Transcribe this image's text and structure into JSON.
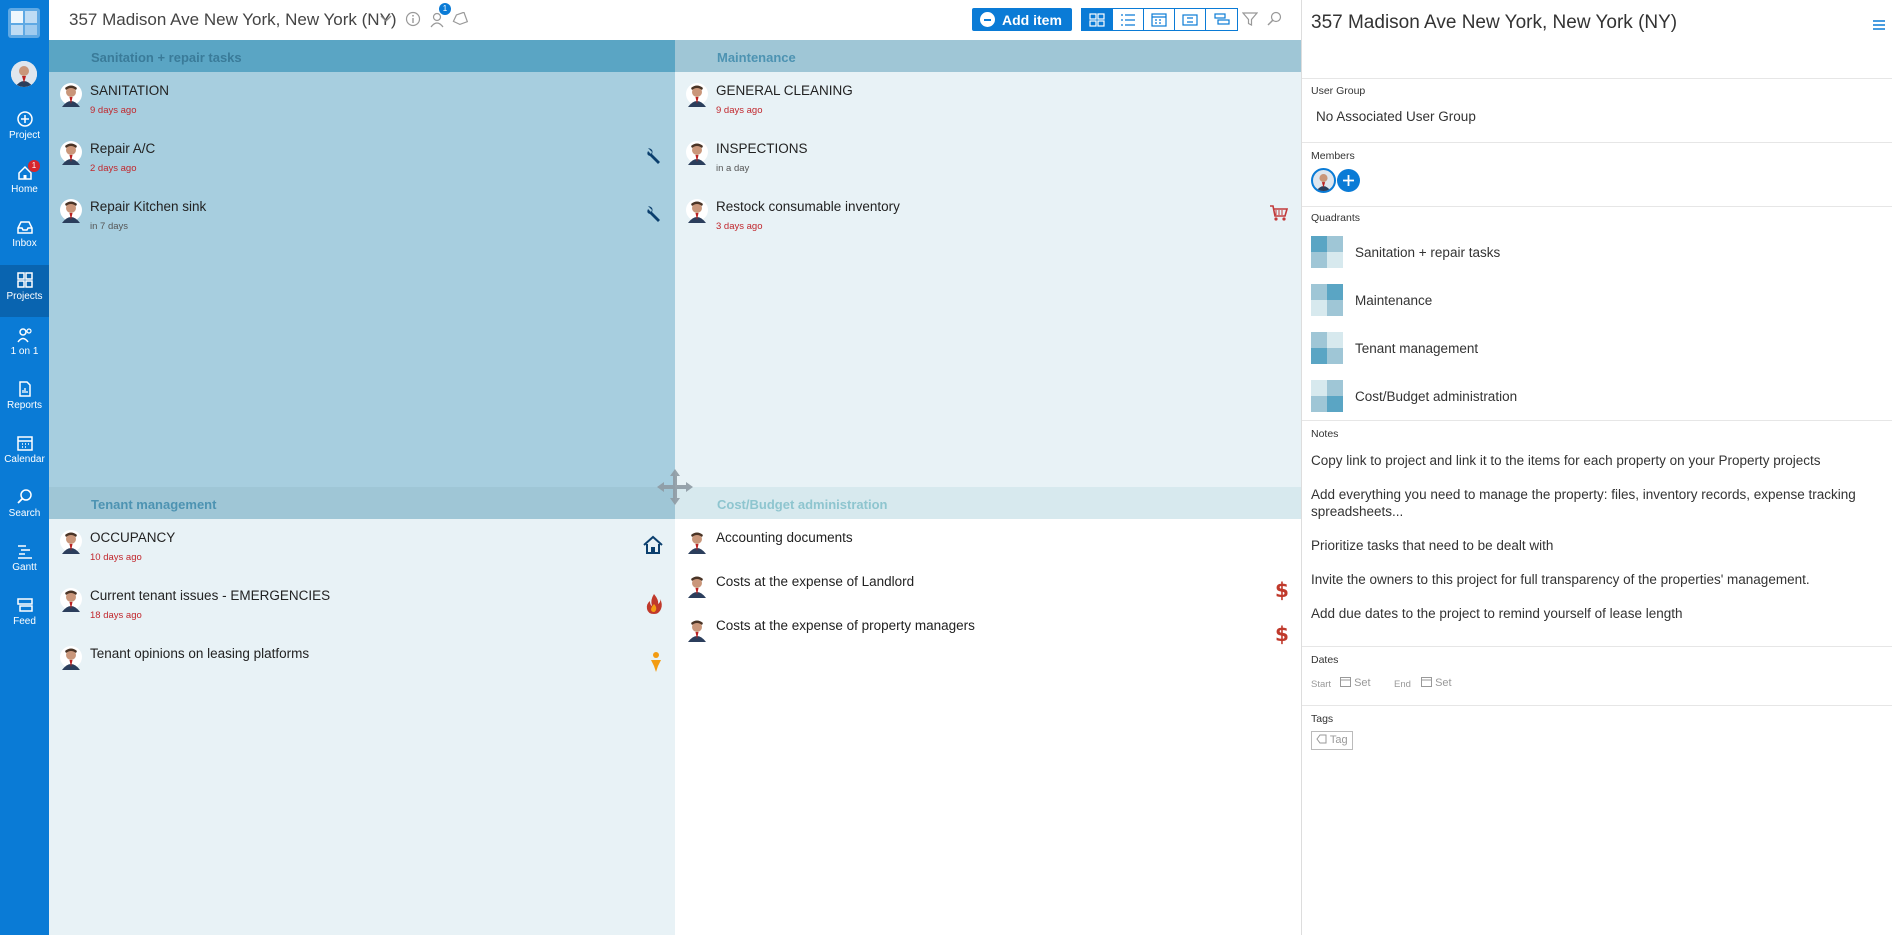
{
  "sidebar": {
    "items": [
      {
        "label": "Project",
        "icon": "plus-circle-icon"
      },
      {
        "label": "Home",
        "icon": "home-icon",
        "badge": "1"
      },
      {
        "label": "Inbox",
        "icon": "inbox-icon"
      },
      {
        "label": "Projects",
        "icon": "grid-icon",
        "active": true
      },
      {
        "label": "1 on 1",
        "icon": "people-icon"
      },
      {
        "label": "Reports",
        "icon": "report-icon"
      },
      {
        "label": "Calendar",
        "icon": "calendar-icon"
      },
      {
        "label": "Search",
        "icon": "search-icon"
      },
      {
        "label": "Gantt",
        "icon": "gantt-icon"
      },
      {
        "label": "Feed",
        "icon": "feed-icon"
      }
    ]
  },
  "topbar": {
    "project_title": "357 Madison Ave New York, New York (NY)",
    "members_badge": "1",
    "add_item_label": "Add item"
  },
  "quadrants": [
    {
      "name": "Sanitation + repair tasks",
      "header_bg": "#5aa5c4",
      "body_bg": "#a7cedf",
      "header_color": "#3a7b99",
      "items": [
        {
          "title": "SANITATION",
          "date": "9 days ago",
          "overdue": true,
          "icon": ""
        },
        {
          "title": "Repair A/C",
          "date": "2 days ago",
          "overdue": true,
          "icon": "wrench-icon"
        },
        {
          "title": "Repair Kitchen sink",
          "date": "in 7 days",
          "overdue": false,
          "icon": "wrench-icon"
        }
      ]
    },
    {
      "name": "Maintenance",
      "header_bg": "#9fc6d6",
      "body_bg": "#e8f2f6",
      "header_color": "#4d93b2",
      "items": [
        {
          "title": "GENERAL CLEANING",
          "date": "9 days ago",
          "overdue": true,
          "icon": ""
        },
        {
          "title": "INSPECTIONS",
          "date": "in a day",
          "overdue": false,
          "icon": ""
        },
        {
          "title": "Restock consumable inventory",
          "date": "3 days ago",
          "overdue": true,
          "icon": "cart-icon"
        }
      ]
    },
    {
      "name": "Tenant management",
      "header_bg": "#9fc6d6",
      "body_bg": "#e8f2f6",
      "header_color": "#4d93b2",
      "items": [
        {
          "title": "OCCUPANCY",
          "date": "10 days ago",
          "overdue": true,
          "icon": "house-icon"
        },
        {
          "title": "Current tenant issues - EMERGENCIES",
          "date": "18 days ago",
          "overdue": true,
          "icon": "fire-icon"
        },
        {
          "title": "Tenant opinions on leasing platforms",
          "date": "",
          "overdue": false,
          "icon": "person-orange-icon"
        }
      ]
    },
    {
      "name": "Cost/Budget administration",
      "header_bg": "#d7e9ee",
      "body_bg": "#ffffff",
      "header_color": "#8ec5cf",
      "items": [
        {
          "title": "Accounting documents",
          "date": "",
          "overdue": false,
          "icon": ""
        },
        {
          "title": "Costs at the expense of Landlord",
          "date": "",
          "overdue": false,
          "icon": "dollar-icon"
        },
        {
          "title": "Costs at the expense of property managers",
          "date": "",
          "overdue": false,
          "icon": "dollar-icon"
        }
      ]
    }
  ],
  "panel": {
    "title": "357 Madison Ave New York, New York (NY)",
    "user_group_label": "User Group",
    "user_group_value": "No Associated User Group",
    "members_label": "Members",
    "quadrants_label": "Quadrants",
    "quadrant_names": [
      "Sanitation + repair tasks",
      "Maintenance",
      "Tenant management",
      "Cost/Budget administration"
    ],
    "notes_label": "Notes",
    "notes": [
      "Copy link to project and link it to the items for each property on your Property projects",
      "Add everything you need to manage the property: files, inventory records, expense tracking spreadsheets...",
      "Prioritize tasks that need to be dealt with",
      "Invite the owners to this project for full transparency of the properties' management.",
      "Add due dates to the project to remind yourself of lease length"
    ],
    "dates_label": "Dates",
    "start_label": "Start",
    "end_label": "End",
    "set_label": "Set",
    "tags_label": "Tags",
    "tag_button_label": "Tag"
  }
}
